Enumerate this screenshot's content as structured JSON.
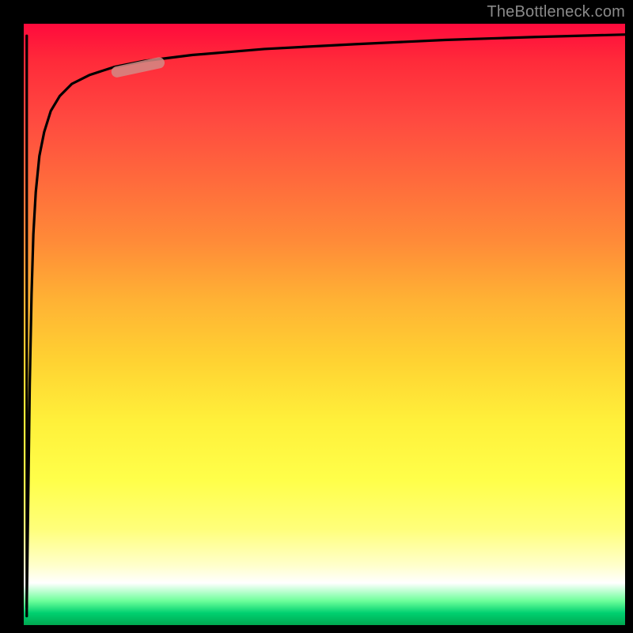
{
  "watermark": {
    "text": "TheBottleneck.com"
  },
  "chart_data": {
    "type": "line",
    "title": "",
    "xlabel": "",
    "ylabel": "",
    "xlim": [
      0,
      100
    ],
    "ylim": [
      0,
      100
    ],
    "curve": {
      "x": [
        0.5,
        0.8,
        1.0,
        1.3,
        1.6,
        2.0,
        2.6,
        3.4,
        4.5,
        6.0,
        8.0,
        11.0,
        15.0,
        20.0,
        28.0,
        40.0,
        55.0,
        70.0,
        85.0,
        100.0
      ],
      "y": [
        3.0,
        25.0,
        40.0,
        55.0,
        65.0,
        72.0,
        78.0,
        82.0,
        85.5,
        88.0,
        90.0,
        91.5,
        92.8,
        93.8,
        94.8,
        95.8,
        96.6,
        97.3,
        97.8,
        98.2
      ]
    },
    "highlight_segment": {
      "x_start": 15.5,
      "y_start": 92.0,
      "x_end": 22.5,
      "y_end": 93.5,
      "color": "#d38a85"
    },
    "background_gradient_stops": [
      {
        "pos": 0.0,
        "color": "#ff0a3c"
      },
      {
        "pos": 0.25,
        "color": "#ff6a3c"
      },
      {
        "pos": 0.55,
        "color": "#ffd232"
      },
      {
        "pos": 0.8,
        "color": "#ffff60"
      },
      {
        "pos": 0.93,
        "color": "#ffffff"
      },
      {
        "pos": 1.0,
        "color": "#00b056"
      }
    ]
  }
}
